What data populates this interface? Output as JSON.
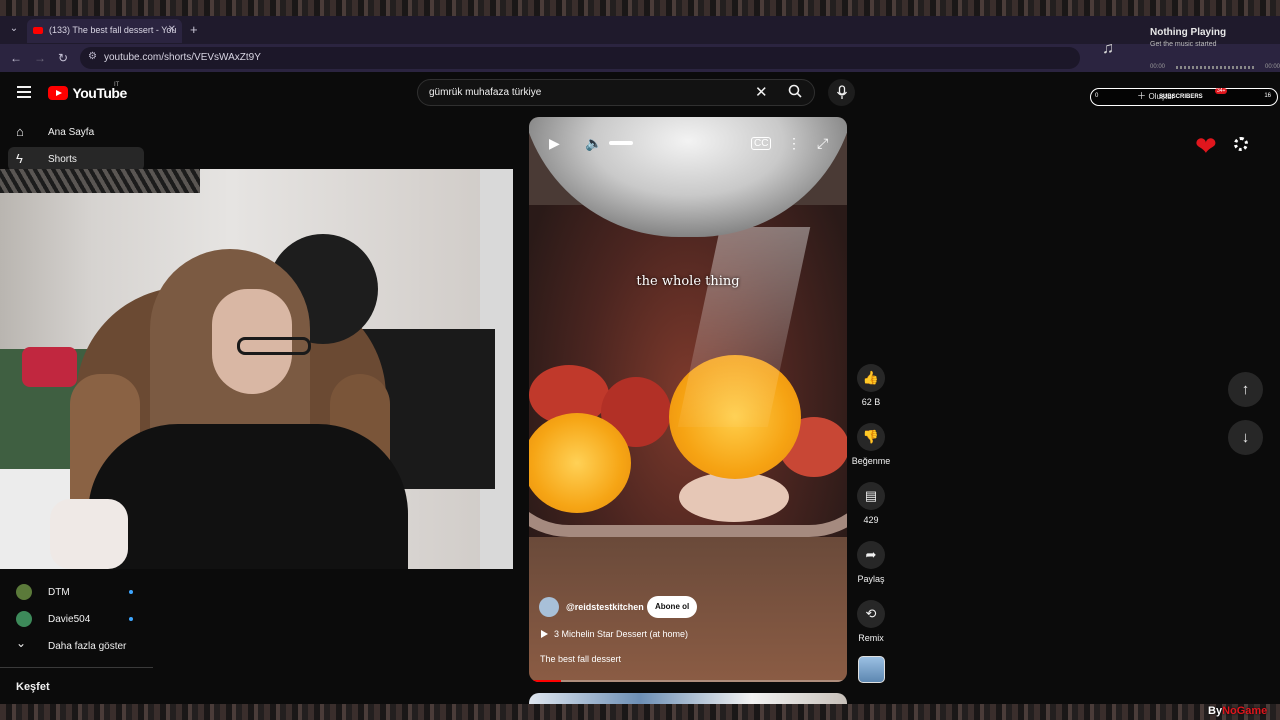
{
  "browser": {
    "tab_title": "(133) The best fall dessert - You",
    "url": "youtube.com/shorts/VEVsWAxZt9Y"
  },
  "now_playing": {
    "title": "Nothing Playing",
    "subtitle": "Get the music started",
    "time_start": "00:00",
    "time_end": "00:00"
  },
  "header": {
    "logo_text": "YouTube",
    "country_code": "IT",
    "search_query": "gümrük muhafaza türkiye"
  },
  "overlay": {
    "left_count": "0",
    "create_label": "Oluştur",
    "subscribers_label": "SUBSCRIBERS",
    "badge": "34+",
    "right_count": "16"
  },
  "sidebar": {
    "home": "Ana Sayfa",
    "shorts": "Shorts",
    "subscriptions": [
      {
        "name": "DTM",
        "color": "#5b7a3a"
      },
      {
        "name": "Davie504",
        "color": "#3d8a5a"
      }
    ],
    "show_more": "Daha fazla göster",
    "explore": "Keşfet"
  },
  "short": {
    "caption": "the whole thing",
    "channel": "@reidstestkitchen",
    "subscribe_label": "Abone ol",
    "playlist": "3 Michelin Star Dessert (at home)",
    "title": "The best fall dessert",
    "progress_fraction": 0.1
  },
  "actions": {
    "likes": "62 B",
    "dislike_label": "Beğenme",
    "comments": "429",
    "share_label": "Paylaş",
    "remix_label": "Remix"
  },
  "watermark": {
    "prefix": "By",
    "name": "NoGame"
  }
}
